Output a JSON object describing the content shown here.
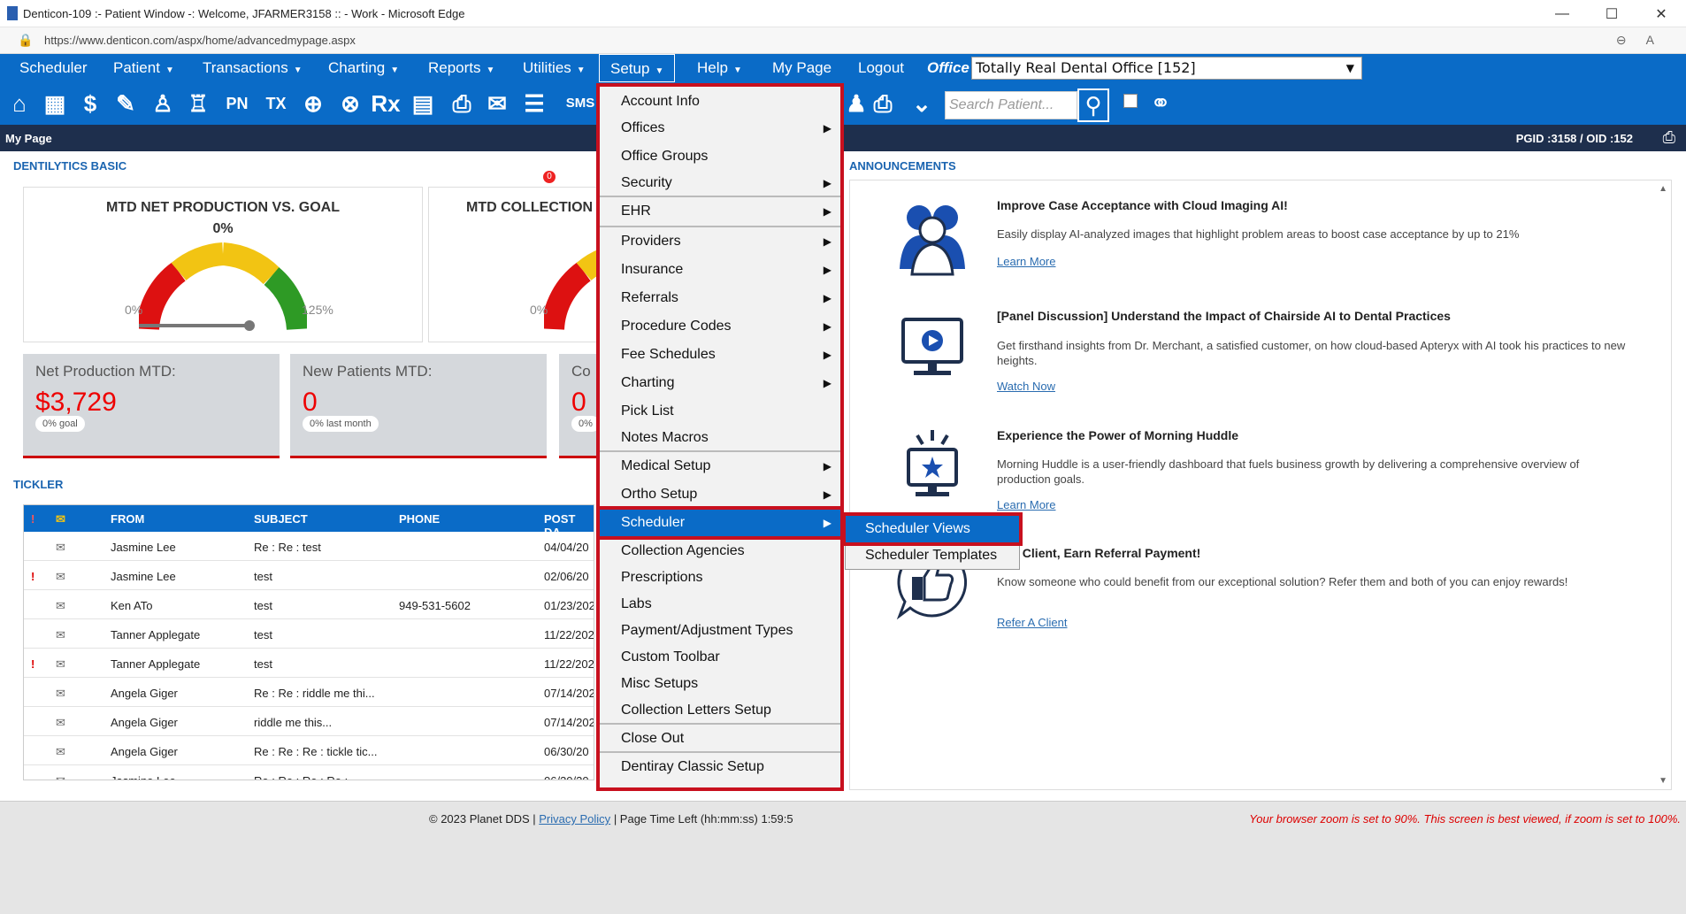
{
  "window": {
    "title": "Denticon-109 :- Patient Window -: Welcome, JFARMER3158 :: - Work - Microsoft Edge",
    "url": "https://www.denticon.com/aspx/home/advancedmypage.aspx",
    "controls": [
      "—",
      "☐",
      "✕"
    ]
  },
  "nav": {
    "items": [
      "Scheduler",
      "Patient",
      "Transactions",
      "Charting",
      "Reports",
      "Utilities",
      "Setup",
      "Help",
      "My Page",
      "Logout"
    ],
    "office_label": "Office",
    "office_value": "Totally Real Dental Office [152]"
  },
  "toolbar": {
    "search_placeholder": "Search Patient...",
    "sms_label": "SMS",
    "rx_label": "Rx",
    "pn_label": "PN",
    "tx_label": "TX",
    "badge_count": "0"
  },
  "pagebar": {
    "label": "My Page",
    "ids": "PGID :3158  /  OID :152"
  },
  "dentilytics": {
    "title": "DENTILYTICS BASIC",
    "gauges": [
      {
        "title": "MTD NET PRODUCTION VS. GOAL",
        "pct": "0%",
        "min": "0%",
        "max": "125%"
      },
      {
        "title": "MTD COLLECTION",
        "min": "0%"
      }
    ],
    "kpis": [
      {
        "label": "Net Production MTD:",
        "value": "$3,729",
        "badge": "0% goal"
      },
      {
        "label": "New Patients MTD:",
        "value": "0",
        "badge": "0% last month"
      },
      {
        "label": "Co",
        "value": "0",
        "badge": "0%"
      }
    ]
  },
  "tickler": {
    "title": "TICKLER",
    "headers": [
      "FROM",
      "SUBJECT",
      "PHONE",
      "POST DA"
    ],
    "rows": [
      {
        "flag": "",
        "from": "Jasmine Lee",
        "subject": "Re : Re : test",
        "phone": "",
        "date": "04/04/20"
      },
      {
        "flag": "!",
        "from": "Jasmine Lee",
        "subject": "test",
        "phone": "",
        "date": "02/06/20"
      },
      {
        "flag": "",
        "from": "Ken ATo",
        "subject": "test",
        "phone": "949-531-5602",
        "date": "01/23/202"
      },
      {
        "flag": "",
        "from": "Tanner Applegate",
        "subject": "test",
        "phone": "",
        "date": "11/22/202"
      },
      {
        "flag": "!",
        "from": "Tanner Applegate",
        "subject": "test",
        "phone": "",
        "date": "11/22/202"
      },
      {
        "flag": "",
        "from": "Angela Giger",
        "subject": "Re : Re : riddle me thi...",
        "phone": "",
        "date": "07/14/202"
      },
      {
        "flag": "",
        "from": "Angela Giger",
        "subject": "riddle me this...",
        "phone": "",
        "date": "07/14/202"
      },
      {
        "flag": "",
        "from": "Angela Giger",
        "subject": "Re : Re : Re : tickle tic...",
        "phone": "",
        "date": "06/30/20"
      },
      {
        "flag": "",
        "from": "Jasmine Lee",
        "subject": "Re : Re : Re : Re :",
        "phone": "",
        "date": "06/30/20"
      }
    ]
  },
  "announcements": {
    "title": "ANNOUNCEMENTS",
    "items": [
      {
        "title": "Improve Case Acceptance with Cloud Imaging AI!",
        "body": "Easily display AI-analyzed images that highlight problem areas to boost case acceptance by up to 21%",
        "link": "Learn More"
      },
      {
        "title": "[Panel Discussion] Understand the Impact of Chairside AI to Dental Practices",
        "body": "Get firsthand insights from Dr. Merchant, a satisfied customer, on how cloud-based Apteryx with AI took his practices to new heights.",
        "link": "Watch Now"
      },
      {
        "title": "Experience the Power of Morning Huddle",
        "body": "Morning Huddle is a user-friendly dashboard that fuels business growth by delivering a comprehensive overview of production goals.",
        "link": "Learn More"
      },
      {
        "title": "er a Client, Earn Referral Payment!",
        "body": "Know someone who could benefit from our exceptional solution? Refer them and both of you can enjoy rewards!",
        "link": "Refer A Client"
      }
    ]
  },
  "setup_menu": {
    "items": [
      {
        "label": "Account Info",
        "sub": false
      },
      {
        "label": "Offices",
        "sub": true
      },
      {
        "label": "Office Groups",
        "sub": false
      },
      {
        "label": "Security",
        "sub": true
      },
      {
        "label": "EHR",
        "sub": true
      },
      {
        "label": "Providers",
        "sub": true
      },
      {
        "label": "Insurance",
        "sub": true
      },
      {
        "label": "Referrals",
        "sub": true
      },
      {
        "label": "Procedure Codes",
        "sub": true
      },
      {
        "label": "Fee Schedules",
        "sub": true
      },
      {
        "label": "Charting",
        "sub": true
      },
      {
        "label": "Pick List",
        "sub": false
      },
      {
        "label": "Notes Macros",
        "sub": false
      },
      {
        "label": "Medical Setup",
        "sub": true
      },
      {
        "label": "Ortho Setup",
        "sub": true
      },
      {
        "label": "Scheduler",
        "sub": true
      },
      {
        "label": "Collection Agencies",
        "sub": false
      },
      {
        "label": "Prescriptions",
        "sub": false
      },
      {
        "label": "Labs",
        "sub": false
      },
      {
        "label": "Payment/Adjustment Types",
        "sub": false
      },
      {
        "label": "Custom Toolbar",
        "sub": false
      },
      {
        "label": "Misc Setups",
        "sub": false
      },
      {
        "label": "Collection Letters Setup",
        "sub": false
      },
      {
        "label": "Close Out",
        "sub": false
      },
      {
        "label": "Dentiray Classic Setup",
        "sub": false
      }
    ],
    "scheduler_sub": [
      "Scheduler Views",
      "Scheduler Templates"
    ]
  },
  "footer": {
    "copyright": "© 2023 Planet DDS |",
    "privacy": "Privacy Policy",
    "time_left": "| Page Time Left (hh:mm:ss) 1:59:5",
    "zoom_warning": "Your browser zoom is set to 90%. This screen is best viewed, if zoom is set to 100%."
  },
  "colors": {
    "nav_blue": "#0a6bc7",
    "highlight_red": "#c8101e",
    "pagebar": "#1e2f4d"
  }
}
